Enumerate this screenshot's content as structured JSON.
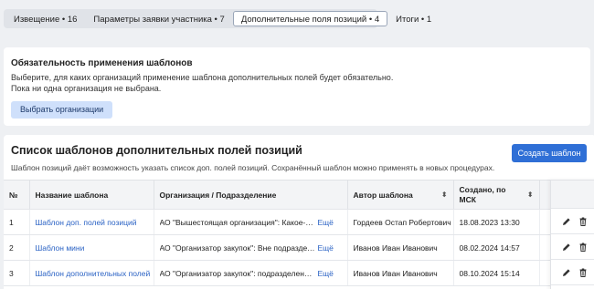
{
  "tabs": [
    {
      "label": "Извещение • 16"
    },
    {
      "label": "Параметры заявки участника • 7"
    },
    {
      "label": "Дополнительные поля позиций • 4"
    },
    {
      "label": "Итоги • 1"
    }
  ],
  "templates_required": {
    "title": "Обязательность применения шаблонов",
    "line1": "Выберите, для каких организаций применение шаблона дополнительных полей будет обязательно.",
    "line2": "Пока ни одна организация не выбрана.",
    "button": "Выбрать организации"
  },
  "templates_list": {
    "title": "Список шаблонов дополнительных полей позиций",
    "description": "Шаблон позиций даёт возможность указать список доп. полей позиций. Сохранённый шаблон можно применять в новых процедурах.",
    "create_button": "Создать шаблон",
    "columns": {
      "num": "№",
      "name": "Название шаблона",
      "org": "Организация / Подразделение",
      "author": "Автор шаблона",
      "created_1": "Создано, по",
      "created_2": "МСК"
    },
    "more_label": "Ещё",
    "rows": [
      {
        "num": "1",
        "name": "Шаблон доп. полей позиций",
        "org": "АО \"Вышестоящая организация\": Какое-то подразделение",
        "author": "Гордеев Остап Робертович",
        "created": "18.08.2023 13:30"
      },
      {
        "num": "2",
        "name": "Шаблон мини",
        "org": "АО \"Организатор закупок\": Вне подразделений",
        "author": "Иванов Иван Иванович",
        "created": "08.02.2024 14:57"
      },
      {
        "num": "3",
        "name": "Шаблон дополнительных полей",
        "org": "АО \"Организатор закупок\": подразделение закупок",
        "author": "Иванов Иван Иванович",
        "created": "08.10.2024 15:14"
      }
    ]
  },
  "colors": {
    "accent": "#2f6fd6",
    "link": "#2a62c4"
  }
}
